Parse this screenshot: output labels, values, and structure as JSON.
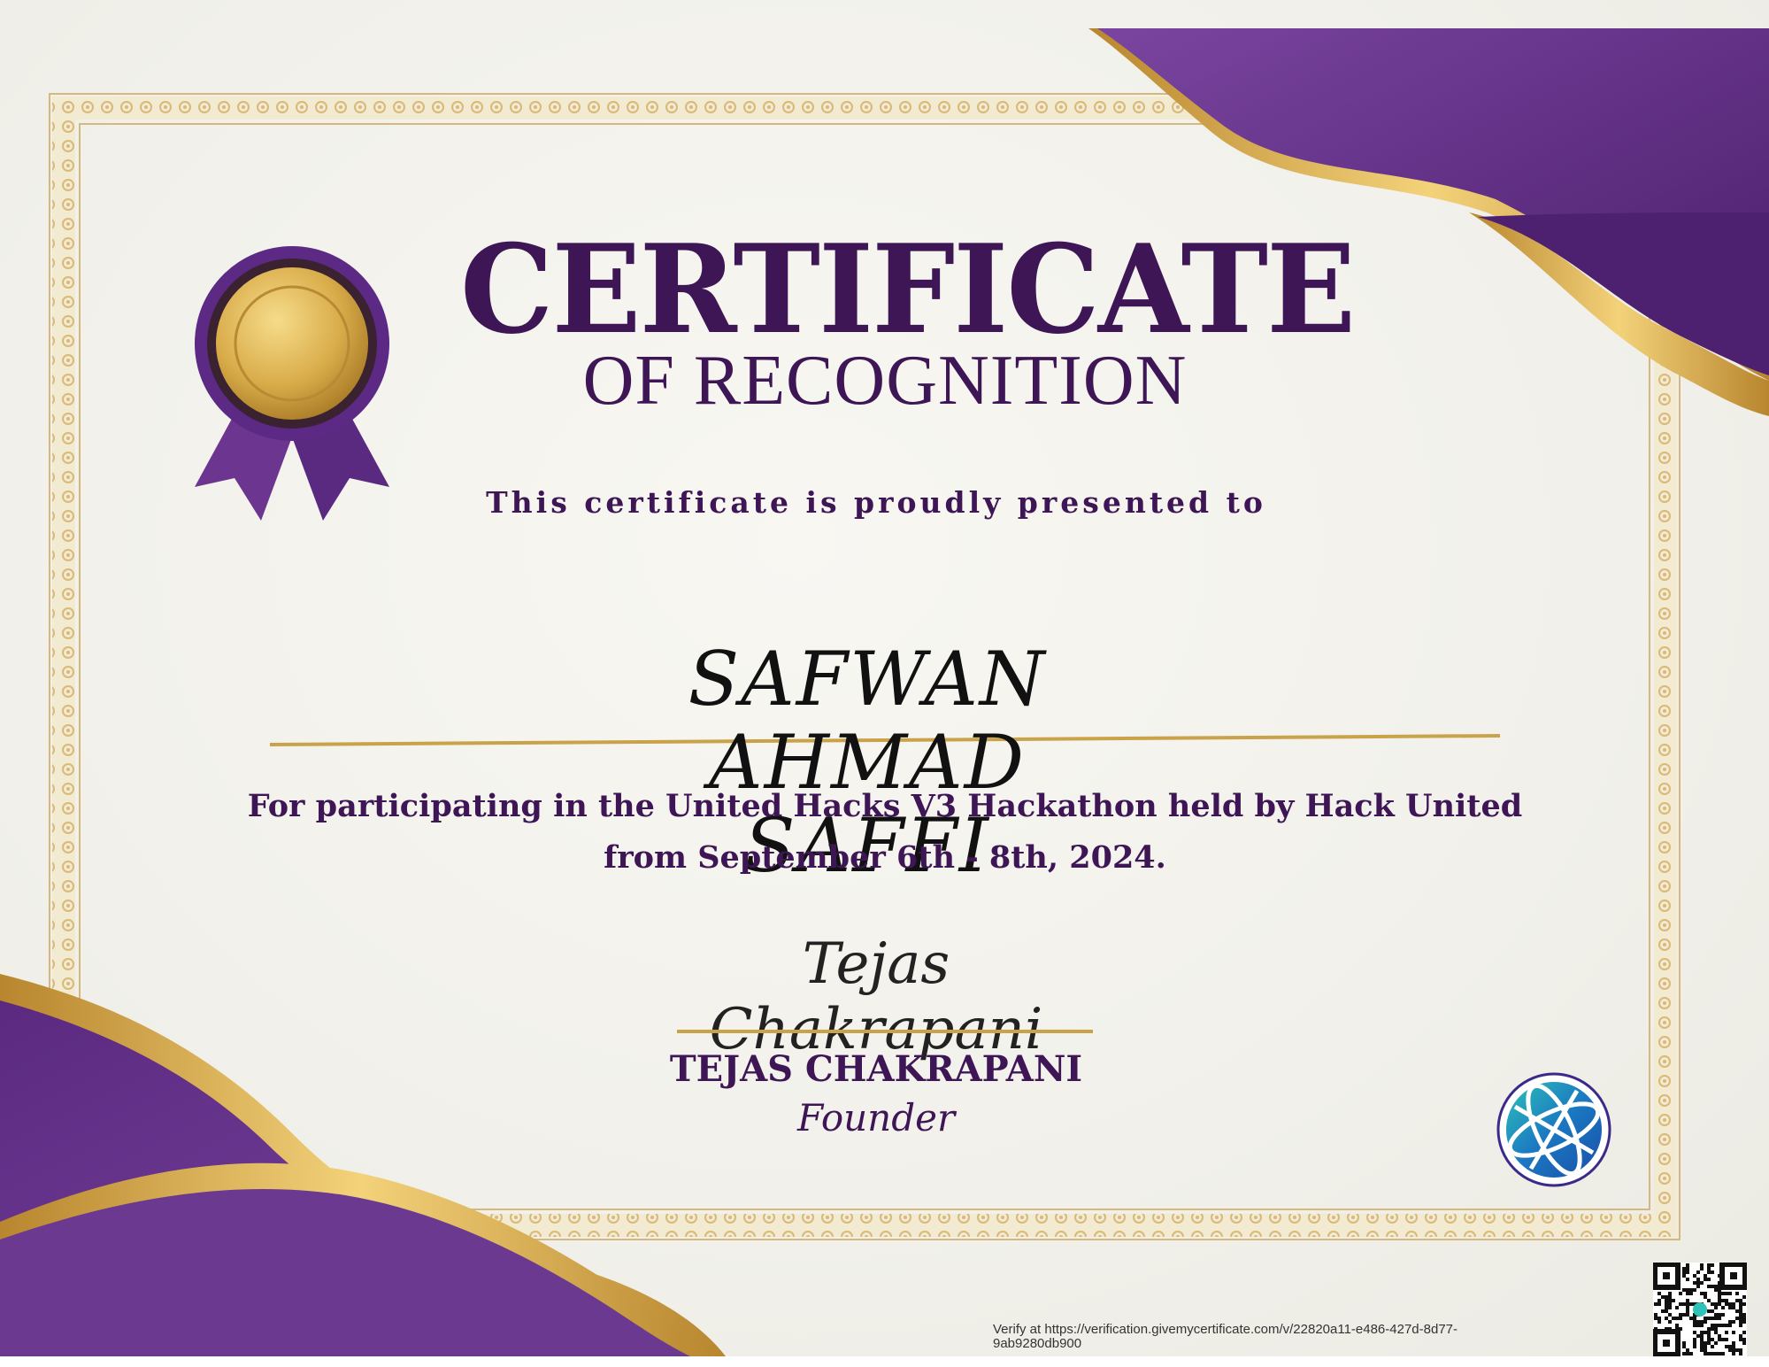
{
  "certificate": {
    "title": "CERTIFICATE",
    "subtitle": "OF RECOGNITION",
    "presented_line": "This certificate is proudly presented to",
    "recipient_name": "SAFWAN\nAHMAD\nSAFFI",
    "description": "For participating in the United Hacks V3 Hackathon held by Hack United from September 6th - 8th, 2024.",
    "signature_script": "Tejas Chakrapani",
    "signer_name": "TEJAS CHAKRAPANI",
    "signer_title": "Founder",
    "verify_text": "Verify at https://verification.givemycertificate.com/v/22820a11-e486-427d-8d77-9ab9280db900"
  },
  "icons": {
    "seal": "award-ribbon-seal-icon",
    "logo": "globe-logo-icon",
    "qr": "qr-code-icon"
  },
  "colors": {
    "primary_purple": "#3e1656",
    "accent_purple": "#6a3a8c",
    "gold": "#c9a24a",
    "paper": "#f2f1ec"
  }
}
